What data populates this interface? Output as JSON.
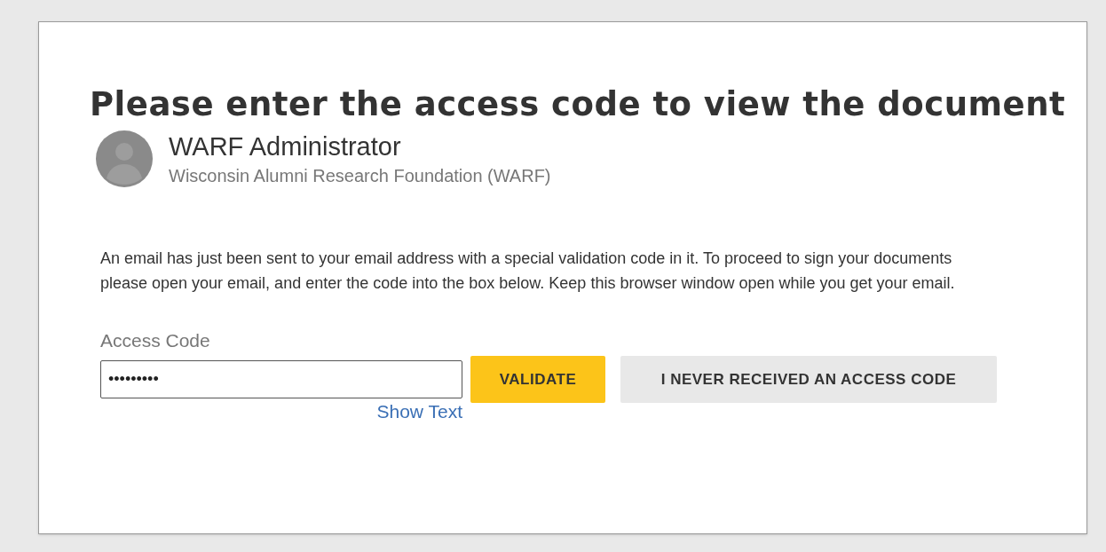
{
  "title": "Please enter the access code to view the document",
  "sender": {
    "name": "WARF Administrator",
    "organization": "Wisconsin Alumni Research Foundation (WARF)"
  },
  "message": "An email has just been sent to your email address with a special validation code in it. To proceed to sign your documents please open your email, and enter the code into the box below. Keep this browser window open while you get your email.",
  "access_code": {
    "label": "Access Code",
    "value": "•••••••••",
    "show_text_link": "Show Text"
  },
  "buttons": [
    {
      "kind": "primary",
      "label": "VALIDATE"
    },
    {
      "kind": "secondary",
      "label": "I NEVER RECEIVED AN ACCESS CODE"
    }
  ]
}
